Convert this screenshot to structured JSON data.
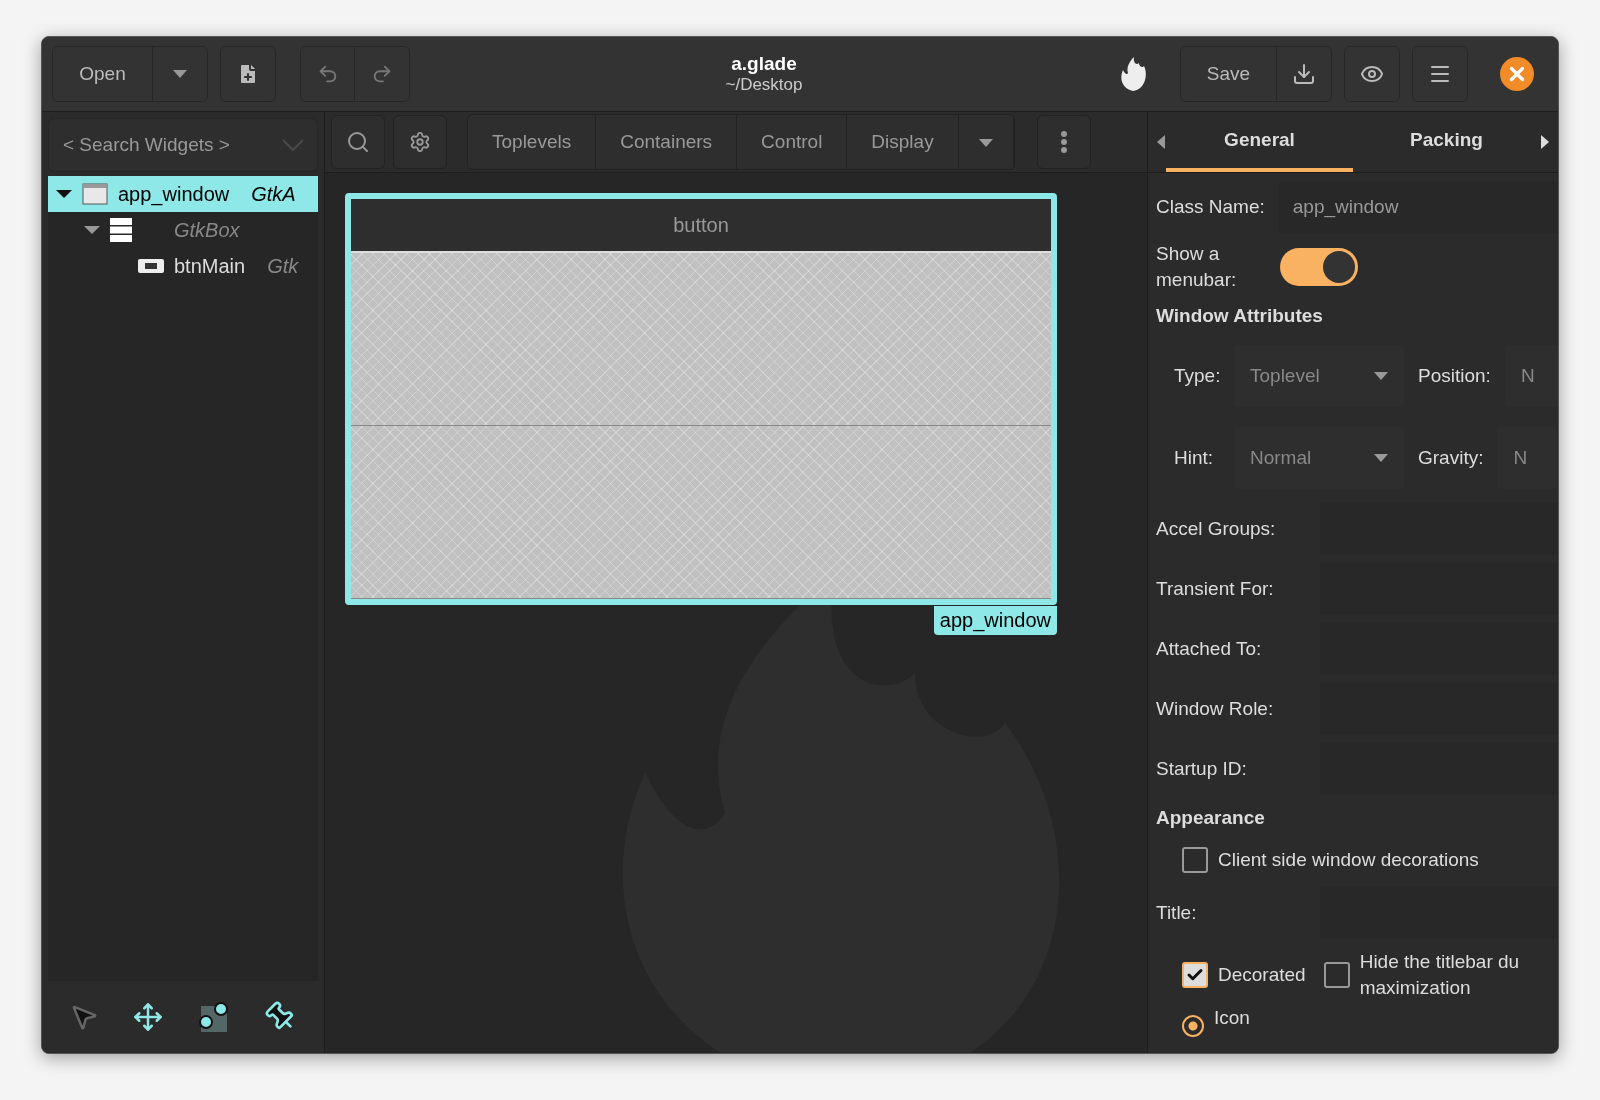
{
  "header": {
    "open_button": "Open",
    "title": "a.glade",
    "subtitle": "~/Desktop",
    "save_button": "Save"
  },
  "search": {
    "placeholder": "< Search Widgets >"
  },
  "tree": [
    {
      "name": "app_window",
      "type": "GtkA",
      "kind": "window",
      "selected": true,
      "expanded": true,
      "children": [
        {
          "type": "GtkBox",
          "kind": "box",
          "selected": false,
          "expanded": true,
          "children": [
            {
              "name": "btnMain",
              "type": "Gtk",
              "kind": "button",
              "selected": false
            }
          ]
        }
      ]
    }
  ],
  "palette": {
    "tabs": [
      "Toplevels",
      "Containers",
      "Control",
      "Display"
    ]
  },
  "canvas": {
    "header_label": "button",
    "window_label": "app_window"
  },
  "inspector": {
    "tabs": [
      {
        "label": "General",
        "selected": true
      },
      {
        "label": "Packing",
        "selected": false
      }
    ],
    "properties": [
      {
        "kind": "entry",
        "label": "Class Name:",
        "value": "app_window"
      },
      {
        "kind": "switch",
        "label": "Show a menubar:",
        "on": true
      },
      {
        "kind": "heading",
        "label": "Window Attributes"
      },
      {
        "kind": "combo_pair",
        "label": "Type:",
        "value": "Toplevel",
        "label2": "Position:",
        "value2": "N"
      },
      {
        "kind": "combo_pair",
        "label": "Hint:",
        "value": "Normal",
        "label2": "Gravity:",
        "value2": "N"
      },
      {
        "kind": "entry",
        "label": "Accel Groups:"
      },
      {
        "kind": "entry",
        "label": "Transient For:"
      },
      {
        "kind": "entry",
        "label": "Attached To:"
      },
      {
        "kind": "entry",
        "label": "Window Role:"
      },
      {
        "kind": "entry",
        "label": "Startup ID:"
      },
      {
        "kind": "heading",
        "label": "Appearance"
      },
      {
        "kind": "check",
        "label": "Client side window decorations",
        "checked": false
      },
      {
        "kind": "entry",
        "label": "Title:"
      },
      {
        "kind": "check_pair",
        "label": "Decorated",
        "checked": true,
        "label2": "Hide the titlebar du\nmaximization",
        "checked2": false
      },
      {
        "kind": "radio",
        "label": "Icon",
        "selected": true
      }
    ]
  }
}
